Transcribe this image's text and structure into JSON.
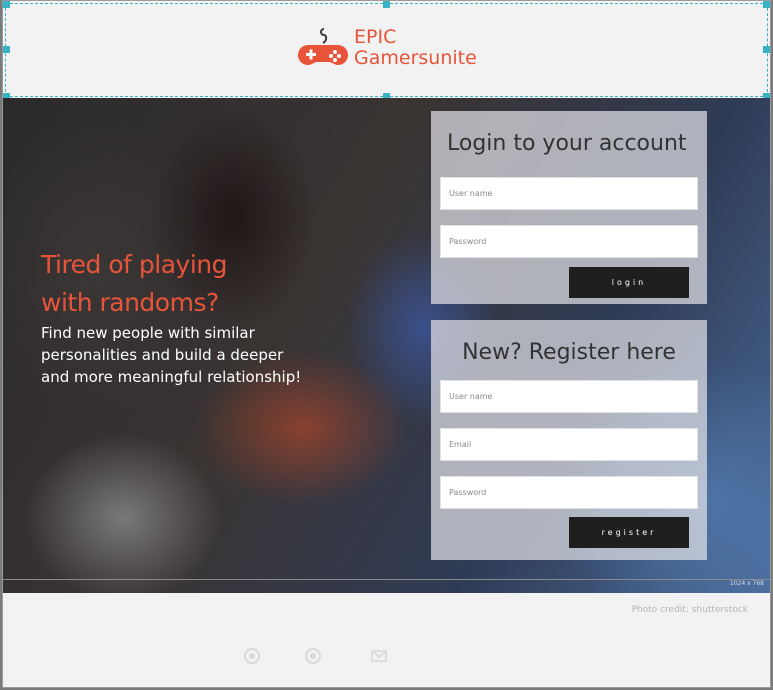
{
  "header": {
    "logo_line1": "EPIC",
    "logo_line2": "Gamersunite",
    "logo_icon": "gamepad-icon",
    "accent_color": "#e8543a",
    "selection_color": "#36b3c4"
  },
  "hero": {
    "headline_line1": "Tired of playing",
    "headline_line2": "with randoms?",
    "body": "Find new people with similar personalities and build a deeper and more meaningful relationship!",
    "image_size_label": "1024 x 768"
  },
  "login": {
    "title": "Login to your account",
    "username_placeholder": "User name",
    "password_placeholder": "Password",
    "button_label": "login"
  },
  "register": {
    "title": "New? Register here",
    "username_placeholder": "User name",
    "email_placeholder": "Email",
    "password_placeholder": "Password",
    "button_label": "register"
  },
  "footer": {
    "credit": "Photo credit: shutterstock",
    "icons": [
      "social-icon-1",
      "social-icon-2",
      "mail-icon"
    ]
  }
}
